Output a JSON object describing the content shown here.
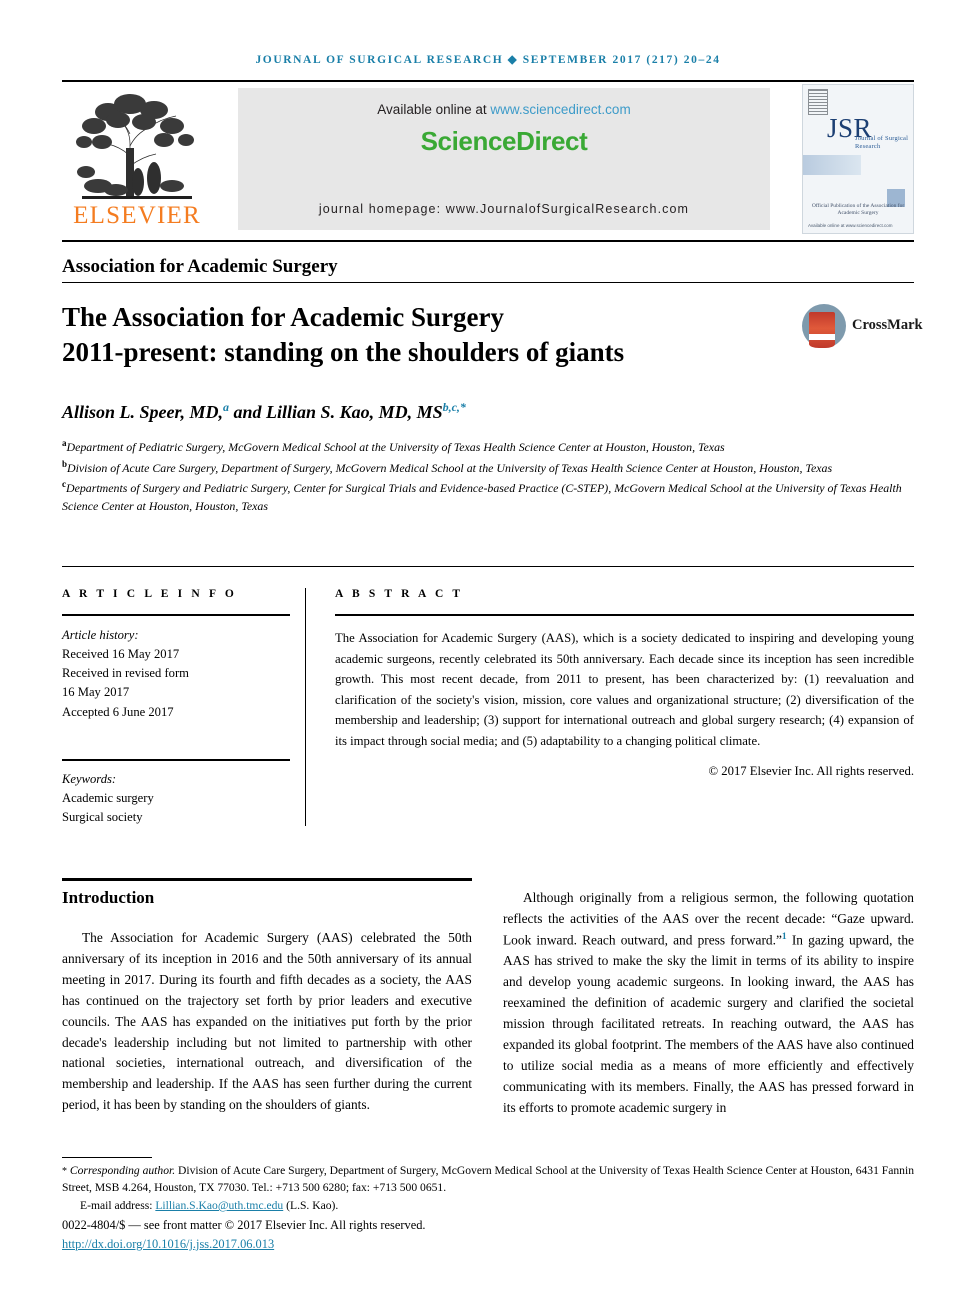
{
  "running_head": "JOURNAL OF SURGICAL RESEARCH ◆ SEPTEMBER 2017 (217) 20–24",
  "masthead": {
    "publisher_name": "ELSEVIER",
    "publisher_logo_icon": "elsevier-tree-icon",
    "available_prefix": "Available online at ",
    "available_url": "www.sciencedirect.com",
    "sciencedirect_logo": "ScienceDirect",
    "journal_homepage": "journal homepage: www.JournalofSurgicalResearch.com",
    "cover": {
      "title": "JSR",
      "subtitle": "Journal of Surgical Research",
      "note": "Official Publication of the Association for Academic Surgery",
      "footer": "Available online at www.sciencedirect.com"
    }
  },
  "article": {
    "section_label": "Association for Academic Surgery",
    "title_line1": "The Association for Academic Surgery",
    "title_line2": "2011-present: standing on the shoulders of giants",
    "crossmark_label": "CrossMark",
    "authors_part1": "Allison L. Speer, MD,",
    "authors_sup1": "a",
    "authors_part2": " and Lillian S. Kao, MD, MS",
    "authors_sup2": "b,c,*",
    "affiliations": [
      {
        "marker": "a",
        "text": "Department of Pediatric Surgery, McGovern Medical School at the University of Texas Health Science Center at Houston, Houston, Texas"
      },
      {
        "marker": "b",
        "text": "Division of Acute Care Surgery, Department of Surgery, McGovern Medical School at the University of Texas Health Science Center at Houston, Houston, Texas"
      },
      {
        "marker": "c",
        "text": "Departments of Surgery and Pediatric Surgery, Center for Surgical Trials and Evidence-based Practice (C-STEP), McGovern Medical School at the University of Texas Health Science Center at Houston, Houston, Texas"
      }
    ]
  },
  "article_info": {
    "heading": "A R T I C L E   I N F O",
    "history_label": "Article history:",
    "history": [
      "Received 16 May 2017",
      "Received in revised form",
      "16 May 2017",
      "Accepted 6 June 2017"
    ],
    "keywords_label": "Keywords:",
    "keywords": [
      "Academic surgery",
      "Surgical society"
    ]
  },
  "abstract": {
    "heading": "A B S T R A C T",
    "text": "The Association for Academic Surgery (AAS), which is a society dedicated to inspiring and developing young academic surgeons, recently celebrated its 50th anniversary. Each decade since its inception has seen incredible growth. This most recent decade, from 2011 to present, has been characterized by: (1) reevaluation and clarification of the society's vision, mission, core values and organizational structure; (2) diversification of the membership and leadership; (3) support for international outreach and global surgery research; (4) expansion of its impact through social media; and (5) adaptability to a changing political climate.",
    "copyright": "© 2017 Elsevier Inc. All rights reserved."
  },
  "body": {
    "intro_heading": "Introduction",
    "left_paragraph": "The Association for Academic Surgery (AAS) celebrated the 50th anniversary of its inception in 2016 and the 50th anniversary of its annual meeting in 2017. During its fourth and fifth decades as a society, the AAS has continued on the trajectory set forth by prior leaders and executive councils. The AAS has expanded on the initiatives put forth by the prior decade's leadership including but not limited to partnership with other national societies, international outreach, and diversification of the membership and leadership. If the AAS has seen further during the current period, it has been by standing on the shoulders of giants.",
    "right_paragraph_part1": "Although originally from a religious sermon, the following quotation reflects the activities of the AAS over the recent decade: “Gaze upward. Look inward. Reach outward, and press forward.”",
    "right_reference_marker": "1",
    "right_paragraph_part2": " In gazing upward, the AAS has strived to make the sky the limit in terms of its ability to inspire and develop young academic surgeons. In looking inward, the AAS has reexamined the definition of academic surgery and clarified the societal mission through facilitated retreats. In reaching outward, the AAS has expanded its global footprint. The members of the AAS have also continued to utilize social media as a means of more efficiently and effectively communicating with its members. Finally, the AAS has pressed forward in its efforts to promote academic surgery in"
  },
  "footer": {
    "corresponding_star": "*",
    "corresponding_label": "Corresponding author.",
    "corresponding_text": " Division of Acute Care Surgery, Department of Surgery, McGovern Medical School at the University of Texas Health Science Center at Houston, 6431 Fannin Street, MSB 4.264, Houston, TX 77030. Tel.: +713 500 6280; fax: +713 500 0651.",
    "email_label": "E-mail address: ",
    "email": "Lillian.S.Kao@uth.tmc.edu",
    "email_suffix": " (L.S. Kao).",
    "issn_line": "0022-4804/$ — see front matter © 2017 Elsevier Inc. All rights reserved.",
    "doi": "http://dx.doi.org/10.1016/j.jss.2017.06.013"
  },
  "colors": {
    "accent_teal": "#1a7fa8",
    "elsevier_orange": "#f47c20",
    "sciencedirect_green": "#3aa935",
    "link_blue": "#3d9bc9"
  }
}
